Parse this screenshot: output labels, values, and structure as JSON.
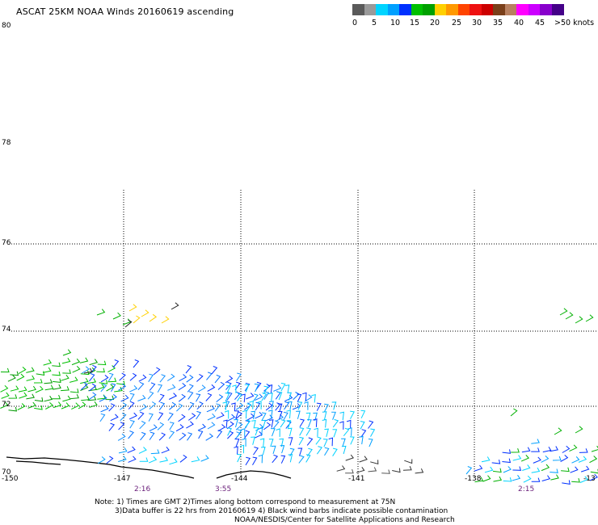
{
  "title": "ASCAT 25KM NOAA Winds 20160619 ascending",
  "colorbar": {
    "labels": [
      "0",
      "5",
      "10",
      "15",
      "20",
      "25",
      "30",
      "35",
      "40",
      "45",
      ">50 knots"
    ],
    "colors": [
      "#5a5a5a",
      "#9a9a9a",
      "#00d4ff",
      "#00a0ff",
      "#0030ff",
      "#00c000",
      "#00a000",
      "#ffd000",
      "#ff9900",
      "#ff4400",
      "#ee1111",
      "#cc0000",
      "#7a3f1a",
      "#b88060",
      "#ff00ff",
      "#cc00ff",
      "#8800cc",
      "#440088"
    ]
  },
  "axes": {
    "lat_labels": [
      "80",
      "78",
      "76",
      "74",
      "72",
      "70"
    ],
    "lon_labels": [
      "-150",
      "-147",
      "-144",
      "-141",
      "-138",
      "-13"
    ]
  },
  "time_labels": [
    "2:16",
    "3:55",
    "2:15"
  ],
  "notes": [
    "Note: 1) Times are GMT 2)Times along bottom correspond to measurement at 75N",
    "3)Data buffer is 22 hrs from 20160619 4) Black wind barbs indicate possible contamination",
    "NOAA/NESDIS/Center for Satellite Applications and Research"
  ]
}
